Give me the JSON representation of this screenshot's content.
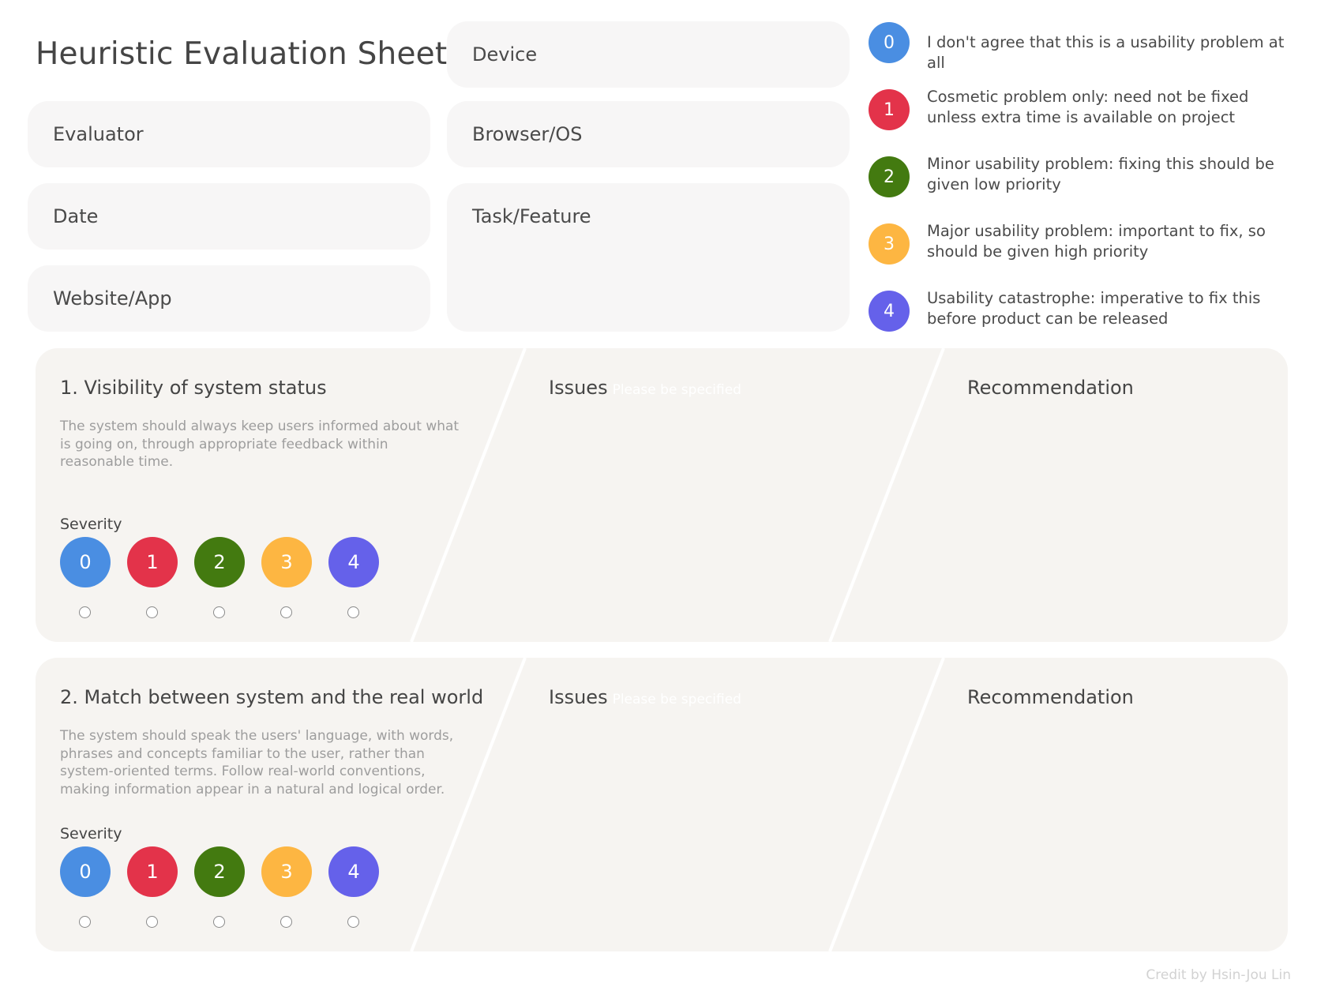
{
  "header": {
    "title": "Heuristic Evaluation Sheet"
  },
  "fields": {
    "device": "Device",
    "evaluator": "Evaluator",
    "browser_os": "Browser/OS",
    "date": "Date",
    "task_feature": "Task/Feature",
    "website_app": "Website/App"
  },
  "severity_colors": [
    "#4a8ee2",
    "#e3334a",
    "#437a10",
    "#fdb642",
    "#6561ea"
  ],
  "legend": [
    {
      "level": "0",
      "text": "I don't agree that this is a usability problem at all",
      "color": "#4a8ee2"
    },
    {
      "level": "1",
      "text": "Cosmetic problem only: need not be fixed unless extra time is available on project",
      "color": "#e3334a"
    },
    {
      "level": "2",
      "text": "Minor usability problem: fixing this should be given low priority",
      "color": "#437a10"
    },
    {
      "level": "3",
      "text": "Major usability problem: important to fix, so should be given high priority",
      "color": "#fdb642"
    },
    {
      "level": "4",
      "text": "Usability catastrophe: imperative to fix this before product can be released",
      "color": "#6561ea"
    }
  ],
  "heuristics": [
    {
      "title": "1. Visibility of system status",
      "description": "The system should always keep users informed about what is going on, through appropriate feedback within reasonable time.",
      "severity_label": "Severity",
      "levels": [
        "0",
        "1",
        "2",
        "3",
        "4"
      ],
      "issues_label": "Issues",
      "issues_placeholder": "Please be specified",
      "recommendation_label": "Recommendation"
    },
    {
      "title": "2. Match between system and the real world",
      "description": "The system should speak the users' language, with words, phrases and concepts familiar to the user, rather than system-oriented terms. Follow real-world conventions, making information appear in a natural and logical order.",
      "severity_label": "Severity",
      "levels": [
        "0",
        "1",
        "2",
        "3",
        "4"
      ],
      "issues_label": "Issues",
      "issues_placeholder": "Please be specified",
      "recommendation_label": "Recommendation"
    }
  ],
  "footer": {
    "credit": "Credit by Hsin-Jou Lin"
  }
}
